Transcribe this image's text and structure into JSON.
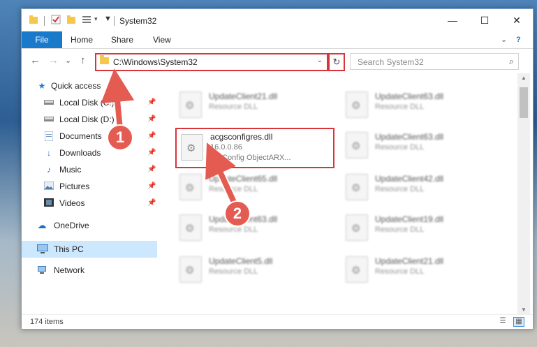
{
  "window": {
    "title": "System32",
    "minimize": "—",
    "maximize": "☐",
    "close": "✕"
  },
  "ribbon": {
    "tabs": [
      "File",
      "Home",
      "Share",
      "View"
    ],
    "collapse": "⌄",
    "help": "?"
  },
  "address": {
    "path": "C:\\Windows\\System32",
    "dropdown": "⌄",
    "refresh": "↻"
  },
  "search": {
    "placeholder": "Search System32"
  },
  "nav": {
    "back": "←",
    "forward": "→",
    "recent": "⌄",
    "up": "↑"
  },
  "sidebar": {
    "items": [
      {
        "label": "Quick access",
        "icon": "star-icon"
      },
      {
        "label": "Local Disk (C:)",
        "icon": "drive-icon"
      },
      {
        "label": "Local Disk (D:)",
        "icon": "drive-icon"
      },
      {
        "label": "Documents",
        "icon": "documents-icon"
      },
      {
        "label": "Downloads",
        "icon": "download-icon"
      },
      {
        "label": "Music",
        "icon": "music-icon"
      },
      {
        "label": "Pictures",
        "icon": "pictures-icon"
      },
      {
        "label": "Videos",
        "icon": "videos-icon"
      },
      {
        "label": "OneDrive",
        "icon": "cloud-icon"
      },
      {
        "label": "This PC",
        "icon": "computer-icon"
      },
      {
        "label": "Network",
        "icon": "network-icon"
      }
    ]
  },
  "files": [
    {
      "name": "UpdateClient21.dll",
      "type": "Resource DLL"
    },
    {
      "name": "UpdateClient63.dll",
      "type": "Resource DLL"
    },
    {
      "name": "UpdateClient63.dll",
      "type": "Resource DLL"
    },
    {
      "name": "UpdateClient65.dll",
      "type": "Resource DLL"
    },
    {
      "name": "UpdateClient42.dll",
      "type": "Resource DLL"
    },
    {
      "name": "UpdateClient63.dll",
      "type": "Resource DLL"
    },
    {
      "name": "UpdateClient19.dll",
      "type": "Resource DLL"
    },
    {
      "name": "UpdateClient5.dll",
      "type": "Resource DLL"
    },
    {
      "name": "UpdateClient21.dll",
      "type": "Resource DLL"
    }
  ],
  "selected_file": {
    "name": "acgsconfigres.dll",
    "version": "16.0.0.86",
    "description": "3D Config ObjectARX..."
  },
  "status": {
    "item_count": "174 items"
  },
  "annotations": {
    "step1": "1",
    "step2": "2",
    "color": "#e45b52"
  }
}
